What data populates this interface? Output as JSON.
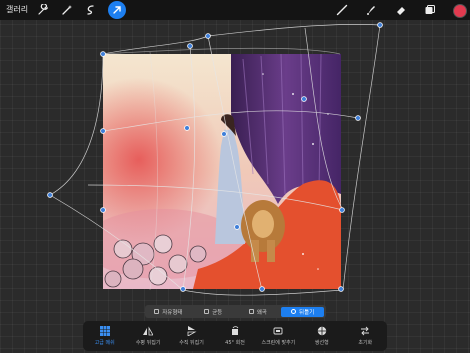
{
  "topbar": {
    "gallery_label": "갤러리",
    "left_icons": [
      "wrench-icon",
      "magic-wand-icon",
      "selection-icon",
      "transform-arrow-icon"
    ],
    "right_icons": [
      "brush-icon",
      "smudge-icon",
      "eraser-icon",
      "layers-icon"
    ],
    "active_color": "#e23a4f"
  },
  "modes": [
    {
      "label": "자유형태",
      "active": false
    },
    {
      "label": "균등",
      "active": false
    },
    {
      "label": "왜곡",
      "active": false
    },
    {
      "label": "뒤틀기",
      "active": true
    }
  ],
  "toolbar": [
    {
      "label": "고급 메쉬",
      "icon": "mesh-grid-icon",
      "active": true
    },
    {
      "label": "수평 뒤집기",
      "icon": "flip-horizontal-icon",
      "active": false
    },
    {
      "label": "수직 뒤집기",
      "icon": "flip-vertical-icon",
      "active": false
    },
    {
      "label": "45° 회전",
      "icon": "rotate-45-icon",
      "active": false
    },
    {
      "label": "스크린에 맞추기",
      "icon": "fit-to-screen-icon",
      "active": false
    },
    {
      "label": "쌍선형",
      "icon": "interpolation-icon",
      "active": false
    },
    {
      "label": "초기화",
      "icon": "reset-icon",
      "active": false
    }
  ],
  "colors": {
    "accent": "#1d7ff0",
    "background": "#2b2b2b",
    "toolbar": "#1b1b1b"
  }
}
